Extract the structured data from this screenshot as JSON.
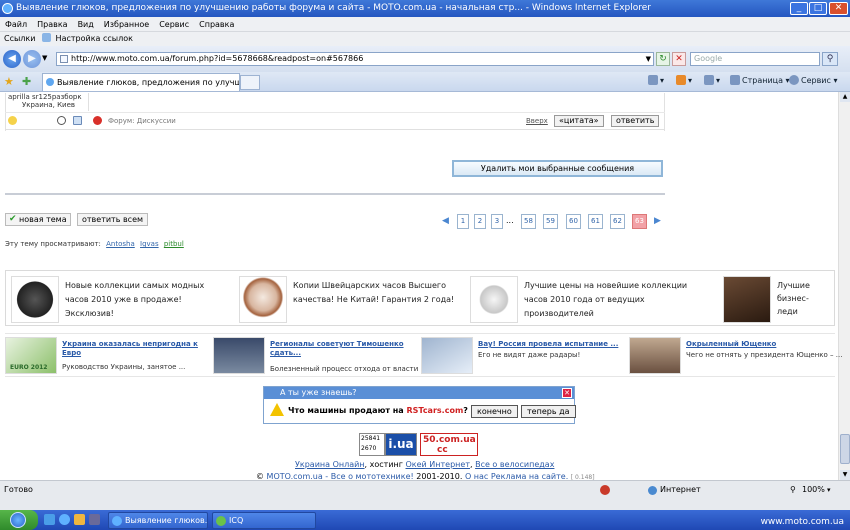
{
  "window": {
    "title": "Выявление глюков, предложения по улучшению работы форума и сайта - MOTO.com.ua - начальная стр... - Windows Internet Explorer"
  },
  "menu": [
    "Файл",
    "Правка",
    "Вид",
    "Избранное",
    "Сервис",
    "Справка"
  ],
  "links_bar": {
    "label": "Ссылки",
    "item": "Настройка ссылок"
  },
  "address": {
    "url": "http://www.moto.com.ua/forum.php?id=5678668&readpost=on#567866",
    "search_placeholder": "Google"
  },
  "tab": {
    "title": "Выявление глюков, предложения по улучшению р..."
  },
  "commands": {
    "page": "Страница",
    "tools": "Сервис"
  },
  "post": {
    "user": "aprilla sr125разборк",
    "city": "Украина, Киев",
    "forum_label": "Форум: Дискуссии",
    "up": "Вверх",
    "quote": "«цитата»",
    "reply": "ответить"
  },
  "delete_button": "Удалить мои выбранные сообщения",
  "topic_buttons": {
    "new": "новая тема",
    "reply_all": "ответить всем"
  },
  "pagination": {
    "pages": [
      "1",
      "2",
      "3",
      "...",
      "58",
      "59",
      "60",
      "61",
      "62",
      "63"
    ],
    "current": "63",
    "prev": "◀",
    "next": "▶"
  },
  "viewers": {
    "label": "Эту тему просматривают:",
    "users": [
      "Antosha",
      "Igvas",
      "pitbul"
    ]
  },
  "ads_row1": [
    {
      "text": "Новые коллекции самых модных часов 2010 уже в продаже! Эксклюзив!"
    },
    {
      "text": "Копии Швейцарских часов Высшего качества! Не Китай! Гарантия 2 года!"
    },
    {
      "text": "Лучшие цены на новейшие коллекции часов 2010 года от ведущих производителей"
    },
    {
      "text": "Лучшие бизнес-леди"
    }
  ],
  "ads_row2": [
    {
      "headline": "Украина оказалась непригодна к Евро",
      "desc": "Руководство Украины, занятое ...",
      "img_caption": "EURO 2012"
    },
    {
      "headline": "Регионалы советуют Тимошенко сдать...",
      "desc": "Болезненный процесс отхода от власти ..."
    },
    {
      "headline": "Вау! Россия провела испытание ...",
      "desc": "Его не видят даже радары!"
    },
    {
      "headline": "Окрыленный Ющенко",
      "desc": "Чего не отнять у президента Ющенко – ..."
    }
  ],
  "popup": {
    "title": "А ты уже знаешь?",
    "question": "Что машины продают на",
    "brand": "RSTcars.com",
    "btn1": "конечно",
    "btn2": "теперь да"
  },
  "counters": {
    "c1_top": "25841",
    "c1_bottom": "2670",
    "iua": "i.ua",
    "site50": "50.com.ua",
    "site50_sub": "cc"
  },
  "footer": {
    "line1_link1": "Украина Онлайн",
    "line1_mid": ", хостинг ",
    "line1_link2": "Окей Интернет",
    "line1_comma": ", ",
    "line1_link3": "Все о велосипедах",
    "copyright": "©",
    "site_link": "MOTO.com.ua - Все о мототехнике!",
    "years": " 2001-2010. ",
    "about": "О нас",
    "ads": "Реклама на сайте.",
    "timing": "[ 0.148]"
  },
  "status": {
    "left": "Готово",
    "zone": "Интернет",
    "zoom": "100%"
  },
  "taskbar": {
    "task1": "Выявление глюков...",
    "task2": "ICQ",
    "watermark": "www.moto.com.ua"
  },
  "colors": {
    "ie_blue": "#2456c0",
    "link": "#2a5aa8",
    "current_page": "#f2a1a6",
    "popup_head": "#5a8fd6"
  }
}
